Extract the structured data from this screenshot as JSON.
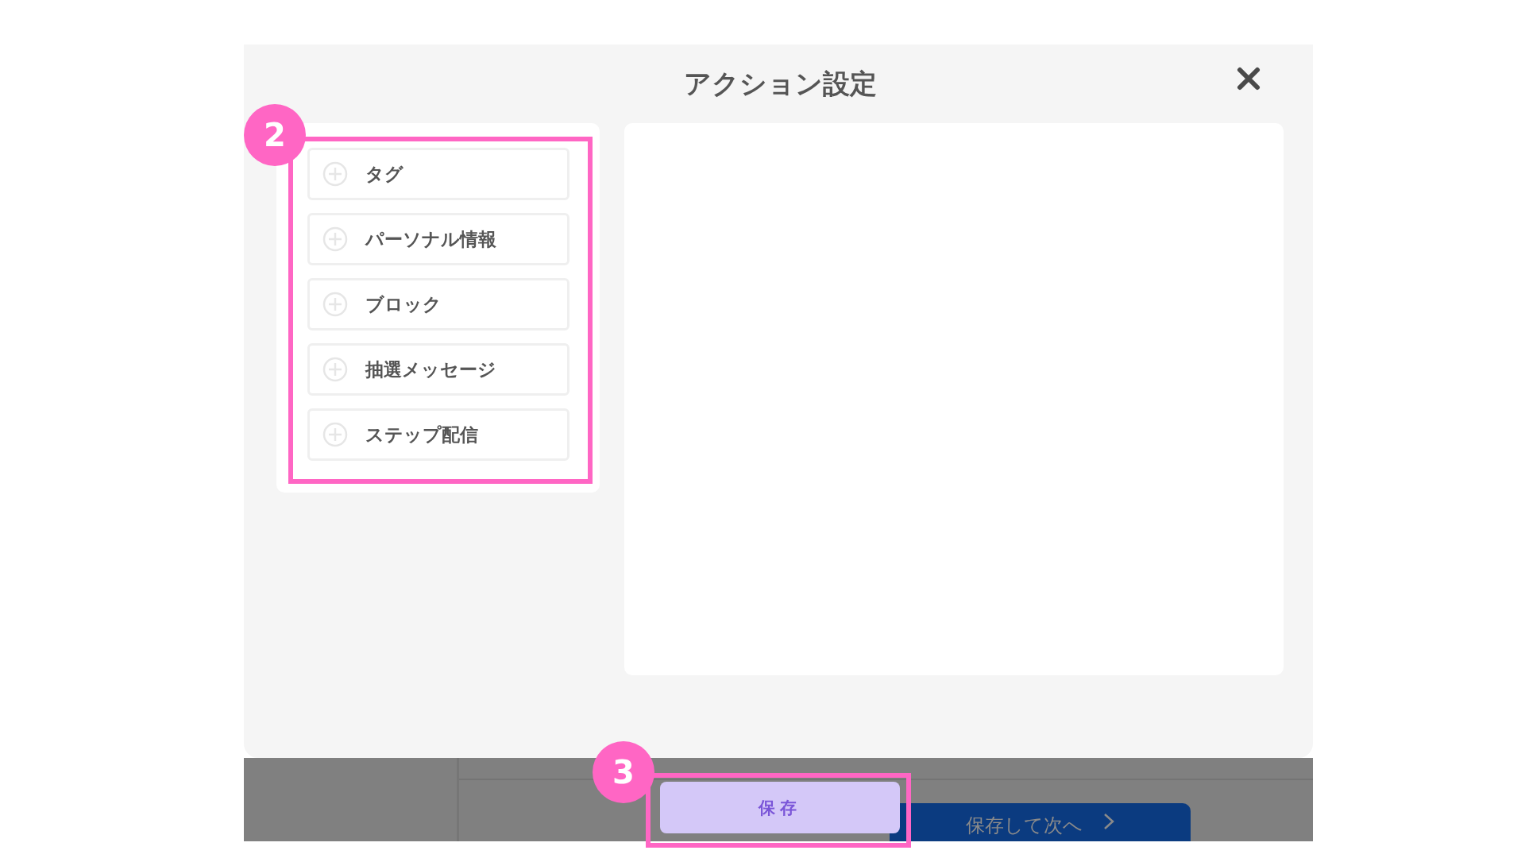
{
  "dialog": {
    "title": "アクション設定",
    "action_items": [
      {
        "label": "タグ"
      },
      {
        "label": "パーソナル情報"
      },
      {
        "label": "ブロック"
      },
      {
        "label": "抽選メッセージ"
      },
      {
        "label": "ステップ配信"
      }
    ]
  },
  "footer": {
    "save_button": "保存",
    "next_button": "保存して次へ"
  },
  "callouts": [
    {
      "number": "2"
    },
    {
      "number": "3"
    }
  ]
}
